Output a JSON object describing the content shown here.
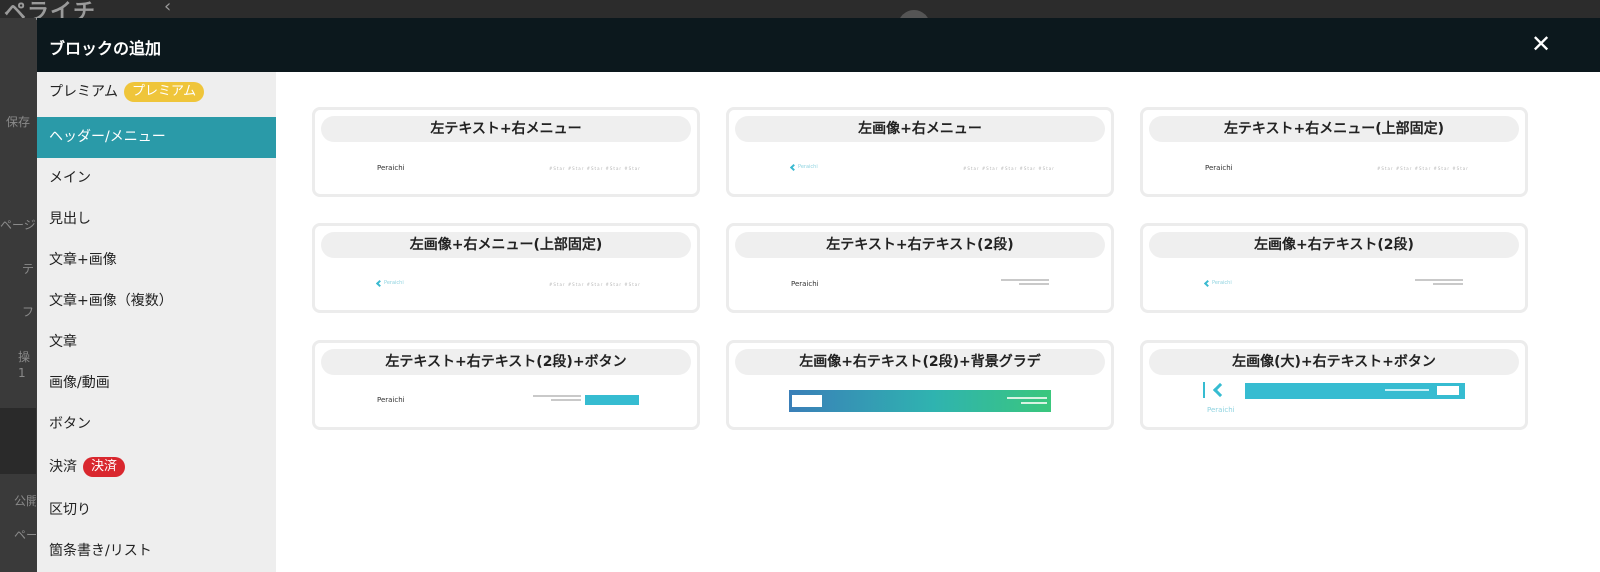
{
  "background": {
    "logo": "ペライチ",
    "collapse_icon": "chevron-left-icon",
    "sidebar_fragments": [
      "保存",
      "ページ",
      "テ",
      "フ",
      "操",
      "1",
      "公開",
      "ペー"
    ]
  },
  "modal": {
    "title": "ブロックの追加",
    "close_label": "✕"
  },
  "sidebar": {
    "items": [
      {
        "label": "プレミアム",
        "badge": "プレミアム",
        "badge_color": "#efc53a",
        "active": false
      },
      {
        "label": "ヘッダー/メニュー",
        "active": true
      },
      {
        "label": "メイン",
        "active": false
      },
      {
        "label": "見出し",
        "active": false
      },
      {
        "label": "文章+画像",
        "active": false
      },
      {
        "label": "文章+画像（複数）",
        "active": false
      },
      {
        "label": "文章",
        "active": false
      },
      {
        "label": "画像/動画",
        "active": false
      },
      {
        "label": "ボタン",
        "active": false
      },
      {
        "label": "決済",
        "badge": "決済",
        "badge_color": "#d9272e",
        "active": false
      },
      {
        "label": "区切り",
        "active": false
      },
      {
        "label": "箇条書き/リスト",
        "active": false
      }
    ]
  },
  "cards": [
    {
      "title": "左テキスト+右メニュー",
      "preview_text": "Peraichi",
      "menu_text": "#Star #Star #Star #Star #Star"
    },
    {
      "title": "左画像+右メニュー",
      "logo_word": "Peraichi",
      "menu_text": "#Star #Star #Star #Star #Star"
    },
    {
      "title": "左テキスト+右メニュー(上部固定)",
      "preview_text": "Peraichi",
      "menu_text": "#Star #Star #Star #Star #Star"
    },
    {
      "title": "左画像+右メニュー(上部固定)",
      "logo_word": "Peraichi",
      "menu_text": "#Star #Star #Star #Star #Star"
    },
    {
      "title": "左テキスト+右テキスト(2段)",
      "preview_text": "Peraichi"
    },
    {
      "title": "左画像+右テキスト(2段)",
      "logo_word": "Peraichi"
    },
    {
      "title": "左テキスト+右テキスト(2段)+ボタン",
      "preview_text": "Peraichi"
    },
    {
      "title": "左画像+右テキスト(2段)+背景グラデ"
    },
    {
      "title": "左画像(大)+右テキスト+ボタン",
      "logo_word": "Peraichi"
    }
  ],
  "colors": {
    "header_bg": "#0c181d",
    "active_item": "#2a9aa8",
    "accent": "#36bcd1"
  }
}
